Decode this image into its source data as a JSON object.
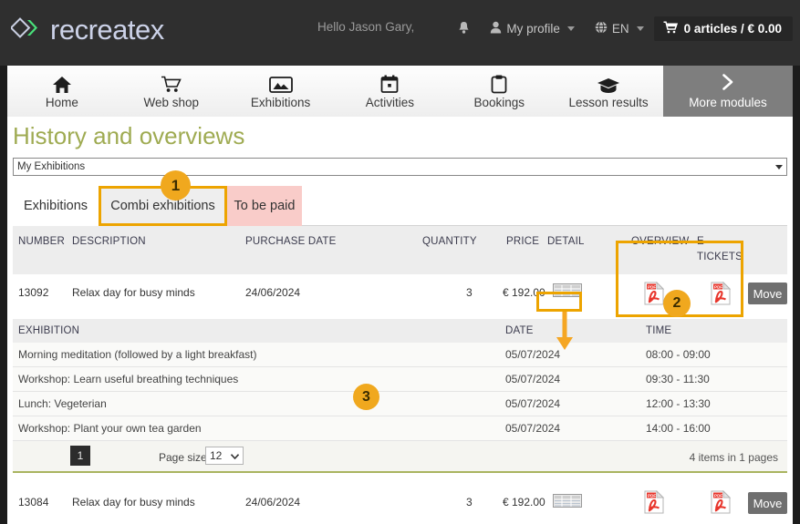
{
  "header": {
    "logo_text": "recreatex",
    "logo_icon": "diamond-chevron-logo",
    "greeting": "Hello Jason Gary,",
    "bell_icon": "notification-bell-icon",
    "profile_icon": "user-icon",
    "profile_label": "My profile",
    "globe_icon": "globe-icon",
    "language": "EN",
    "cart_icon": "shopping-cart-icon",
    "cart_label": "0 articles / € 0.00"
  },
  "nav": {
    "items": [
      {
        "label": "Home",
        "icon": "home-icon"
      },
      {
        "label": "Web shop",
        "icon": "cart-icon"
      },
      {
        "label": "Exhibitions",
        "icon": "image-icon"
      },
      {
        "label": "Activities",
        "icon": "calendar-icon"
      },
      {
        "label": "Bookings",
        "icon": "clipboard-icon"
      },
      {
        "label": "Lesson results",
        "icon": "graduation-cap-icon"
      }
    ],
    "more": {
      "label": "More modules",
      "icon": "chevron-right-icon"
    }
  },
  "main": {
    "title": "History and overviews",
    "filter_select": {
      "value": "My Exhibitions"
    },
    "tabs": [
      {
        "label": "Exhibitions",
        "state": "normal"
      },
      {
        "label": "Combi exhibitions",
        "state": "active"
      },
      {
        "label": "To be paid",
        "state": "alert"
      }
    ],
    "columns": [
      "NUMBER",
      "DESCRIPTION",
      "PURCHASE DATE",
      "QUANTITY",
      "PRICE",
      "DETAIL",
      "OVERVIEW",
      "E-TICKETS"
    ],
    "etickets_header_line1": "E-",
    "etickets_header_line2": "TICKETS",
    "rows": [
      {
        "number": "13092",
        "description": "Relax day for busy minds",
        "purchase_date": "24/06/2024",
        "quantity": "3",
        "price": "€ 192.00",
        "detail_icon": "table-detail-icon",
        "overview_icon": "pdf-icon",
        "eticket_icon": "pdf-icon",
        "move_label": "Move"
      },
      {
        "number": "13084",
        "description": "Relax day for busy minds",
        "purchase_date": "24/06/2024",
        "quantity": "3",
        "price": "€ 192.00",
        "detail_icon": "table-detail-icon",
        "overview_icon": "pdf-icon",
        "eticket_icon": "pdf-icon",
        "move_label": "Move"
      }
    ],
    "detail_table": {
      "columns": [
        "EXHIBITION",
        "DATE",
        "TIME"
      ],
      "rows": [
        {
          "exhibition": "Morning meditation (followed by a light breakfast)",
          "date": "05/07/2024",
          "time": "08:00 - 09:00"
        },
        {
          "exhibition": "Workshop: Learn useful breathing techniques",
          "date": "05/07/2024",
          "time": "09:30 - 11:30"
        },
        {
          "exhibition": "Lunch: Vegeterian",
          "date": "05/07/2024",
          "time": "12:00 - 13:30"
        },
        {
          "exhibition": "Workshop: Plant your own tea garden",
          "date": "05/07/2024",
          "time": "14:00 - 16:00"
        }
      ],
      "pagination": {
        "current_page": "1",
        "page_size_label": "Page size:",
        "page_size_value": "12",
        "items_text": "4 items in 1 pages"
      }
    }
  },
  "annotations": [
    {
      "number": "1"
    },
    {
      "number": "2"
    },
    {
      "number": "3"
    }
  ],
  "colors": {
    "accent_orange": "#eda400",
    "title_green": "#9fab52",
    "alert_pink": "#f9ccc9",
    "header_dark": "#2f2f2f",
    "logo_green": "#49e07a"
  }
}
